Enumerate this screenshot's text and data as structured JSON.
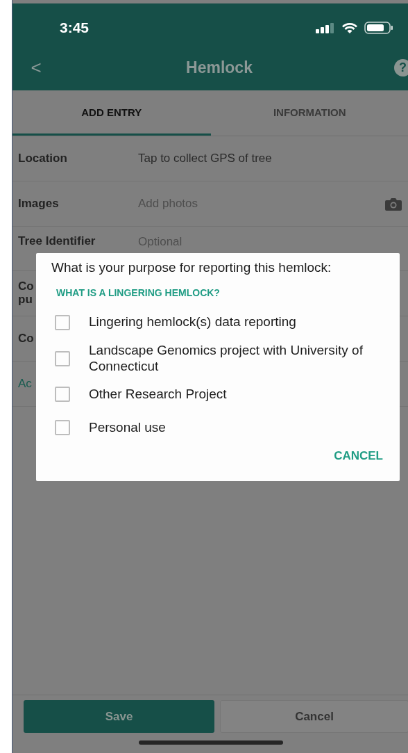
{
  "status_bar": {
    "time": "3:45"
  },
  "header": {
    "back": "<",
    "title": "Hemlock",
    "help": "?"
  },
  "tabs": [
    {
      "label": "ADD ENTRY",
      "selected": true
    },
    {
      "label": "INFORMATION",
      "selected": false
    }
  ],
  "form_rows": [
    {
      "kind": "field",
      "label": "Location",
      "value": "Tap to collect GPS of tree"
    },
    {
      "kind": "photo",
      "label": "Images",
      "placeholder": "Add photos"
    },
    {
      "kind": "field",
      "label": "Tree Identifier",
      "placeholder": "Optional"
    },
    {
      "kind": "field",
      "label": "Co\npu"
    },
    {
      "kind": "field",
      "label": "Co"
    },
    {
      "kind": "link",
      "label": "Ac"
    }
  ],
  "dialog": {
    "title": "What is your purpose for reporting this hemlock:",
    "link": "WHAT IS A LINGERING HEMLOCK?",
    "options": [
      {
        "label": "Lingering hemlock(s) data reporting",
        "checked": false
      },
      {
        "label": "Landscape Genomics project with University of Connecticut",
        "checked": false
      },
      {
        "label": "Other Research Project",
        "checked": false
      },
      {
        "label": "Personal use",
        "checked": false
      }
    ],
    "cancel": "CANCEL"
  },
  "footer": {
    "save": "Save",
    "cancel": "Cancel"
  }
}
